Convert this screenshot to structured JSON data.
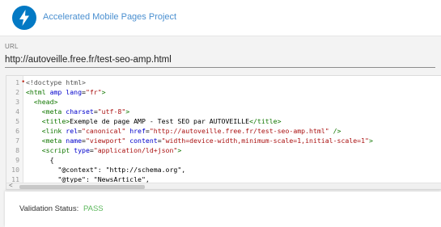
{
  "header": {
    "logo_icon": "lightning-bolt-icon",
    "title": "Accelerated Mobile Pages Project"
  },
  "url": {
    "label": "URL",
    "value": "http://autoveille.free.fr/test-seo-amp.html"
  },
  "editor": {
    "lines": [
      {
        "number": "1",
        "marker": true,
        "tokens": [
          {
            "t": "kw",
            "v": "<!doctype html>"
          }
        ]
      },
      {
        "number": "2",
        "tokens": [
          {
            "t": "tag",
            "v": "<html "
          },
          {
            "t": "attr",
            "v": "amp "
          },
          {
            "t": "attr",
            "v": "lang"
          },
          {
            "t": "plain",
            "v": "="
          },
          {
            "t": "str",
            "v": "\"fr\""
          },
          {
            "t": "tag",
            "v": ">"
          }
        ]
      },
      {
        "number": "3",
        "tokens": [
          {
            "t": "plain",
            "v": "  "
          },
          {
            "t": "tag",
            "v": "<head>"
          }
        ]
      },
      {
        "number": "4",
        "tokens": [
          {
            "t": "plain",
            "v": "    "
          },
          {
            "t": "tag",
            "v": "<meta "
          },
          {
            "t": "attr",
            "v": "charset"
          },
          {
            "t": "plain",
            "v": "="
          },
          {
            "t": "str",
            "v": "\"utf-8\""
          },
          {
            "t": "tag",
            "v": ">"
          }
        ]
      },
      {
        "number": "5",
        "tokens": [
          {
            "t": "plain",
            "v": "    "
          },
          {
            "t": "tag",
            "v": "<title>"
          },
          {
            "t": "plain",
            "v": "Exemple de page AMP - Test SEO par AUTOVEILLE"
          },
          {
            "t": "tag",
            "v": "</title>"
          }
        ]
      },
      {
        "number": "6",
        "tokens": [
          {
            "t": "plain",
            "v": "    "
          },
          {
            "t": "tag",
            "v": "<link "
          },
          {
            "t": "attr",
            "v": "rel"
          },
          {
            "t": "plain",
            "v": "="
          },
          {
            "t": "str",
            "v": "\"canonical\""
          },
          {
            "t": "plain",
            "v": " "
          },
          {
            "t": "attr",
            "v": "href"
          },
          {
            "t": "plain",
            "v": "="
          },
          {
            "t": "str",
            "v": "\"http://autoveille.free.fr/test-seo-amp.html\""
          },
          {
            "t": "plain",
            "v": " "
          },
          {
            "t": "tag",
            "v": "/>"
          }
        ]
      },
      {
        "number": "7",
        "tokens": [
          {
            "t": "plain",
            "v": "    "
          },
          {
            "t": "tag",
            "v": "<meta "
          },
          {
            "t": "attr",
            "v": "name"
          },
          {
            "t": "plain",
            "v": "="
          },
          {
            "t": "str",
            "v": "\"viewport\""
          },
          {
            "t": "plain",
            "v": " "
          },
          {
            "t": "attr",
            "v": "content"
          },
          {
            "t": "plain",
            "v": "="
          },
          {
            "t": "str",
            "v": "\"width=device-width,minimum-scale=1,initial-scale=1\""
          },
          {
            "t": "tag",
            "v": ">"
          }
        ]
      },
      {
        "number": "8",
        "tokens": [
          {
            "t": "plain",
            "v": "    "
          },
          {
            "t": "tag",
            "v": "<script "
          },
          {
            "t": "attr",
            "v": "type"
          },
          {
            "t": "plain",
            "v": "="
          },
          {
            "t": "str",
            "v": "\"application/ld+json\""
          },
          {
            "t": "tag",
            "v": ">"
          }
        ]
      },
      {
        "number": "9",
        "tokens": [
          {
            "t": "plain",
            "v": "      {"
          }
        ]
      },
      {
        "number": "10",
        "tokens": [
          {
            "t": "plain",
            "v": "        \"@context\": \"http://schema.org\","
          }
        ]
      },
      {
        "number": "11",
        "tokens": [
          {
            "t": "plain",
            "v": "        \"@type\": \"NewsArticle\","
          }
        ]
      }
    ],
    "scroll_arrow": "<"
  },
  "status": {
    "label": "Validation Status:",
    "value": "PASS",
    "color": "#5cb85c"
  }
}
